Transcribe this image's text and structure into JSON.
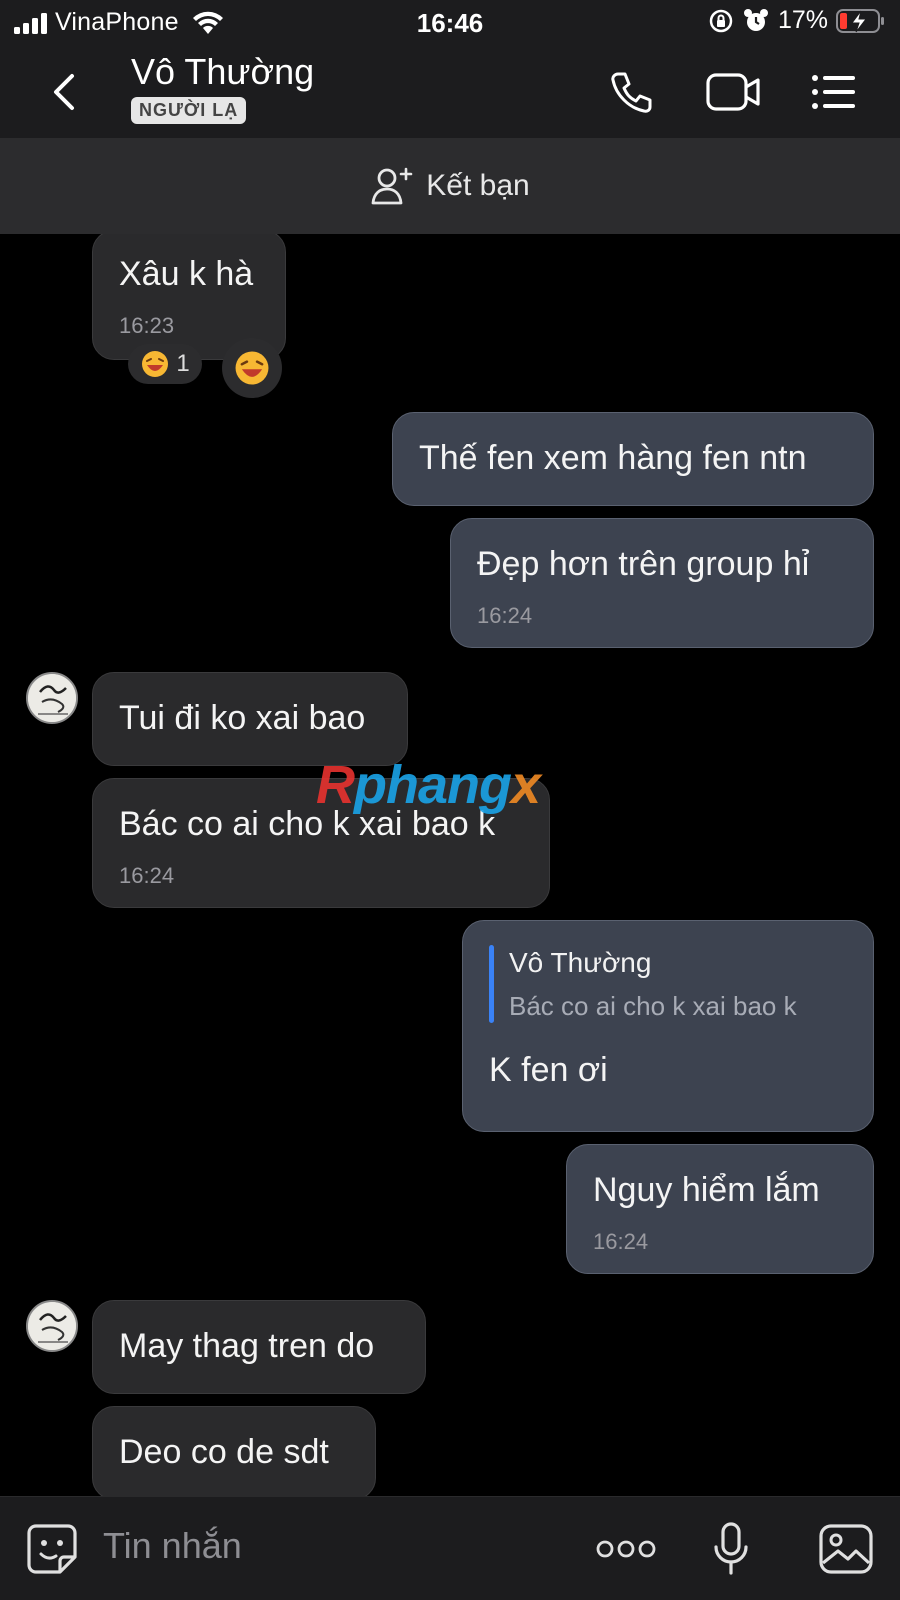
{
  "status_bar": {
    "carrier": "VinaPhone",
    "time": "16:46",
    "battery": "17%"
  },
  "header": {
    "contact_name": "Vô Thường",
    "badge": "NGƯỜI LẠ",
    "icons": [
      "back-icon",
      "phone-icon",
      "video-call-icon",
      "menu-list-icon"
    ]
  },
  "friend_bar": {
    "label": "Kết bạn",
    "icon": "add-friend-icon"
  },
  "messages": [
    {
      "side": "received",
      "text": "Xâu k hà",
      "time": "16:23",
      "reaction_count": "1"
    },
    {
      "side": "sent",
      "text": "Thế fen xem hàng fen ntn"
    },
    {
      "side": "sent",
      "text": "Đẹp hơn trên group hỉ",
      "time": "16:24"
    },
    {
      "side": "received",
      "text": "Tui đi ko xai bao"
    },
    {
      "side": "received",
      "text": "Bác co ai cho k xai bao k",
      "time": "16:24"
    },
    {
      "side": "sent",
      "quote_name": "Vô Thường",
      "quote_text": "Bác co ai cho k xai bao k",
      "text": "K fen ơi"
    },
    {
      "side": "sent",
      "text": "Nguy hiểm lắm",
      "time": "16:24"
    },
    {
      "side": "received",
      "text": "May thag tren do"
    },
    {
      "side": "received",
      "text": "Deo co de sdt"
    }
  ],
  "watermark": {
    "part1": "R",
    "part2": "phang",
    "part3": "x"
  },
  "input_bar": {
    "placeholder": "Tin nhắn",
    "icons": [
      "sticker-icon",
      "more-dots-icon",
      "microphone-icon",
      "image-icon"
    ]
  }
}
